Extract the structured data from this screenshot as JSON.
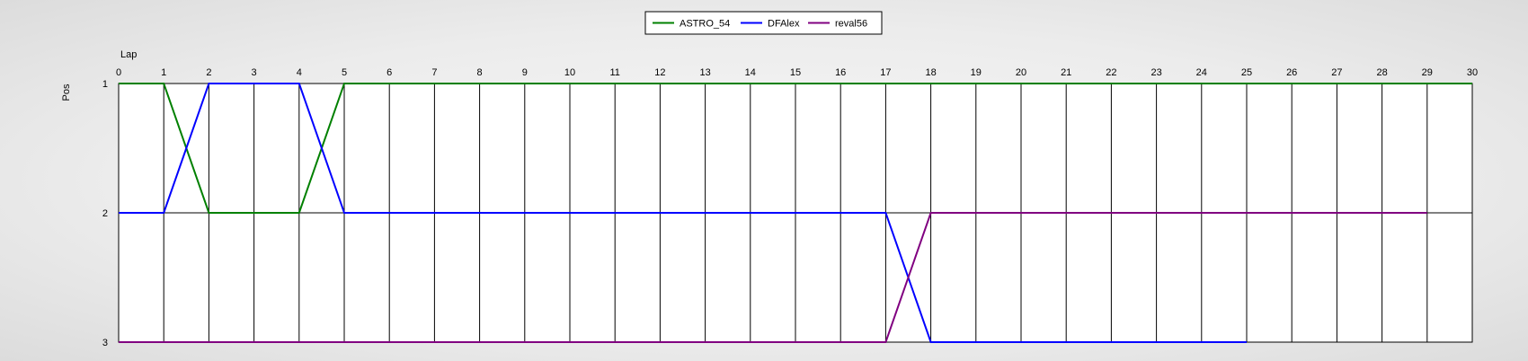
{
  "chart_data": {
    "type": "line",
    "xlabel": "Lap",
    "ylabel": "Pos",
    "xlim": [
      0,
      30
    ],
    "ylim": [
      1,
      3
    ],
    "y_inverted": true,
    "x_ticks": [
      0,
      1,
      2,
      3,
      4,
      5,
      6,
      7,
      8,
      9,
      10,
      11,
      12,
      13,
      14,
      15,
      16,
      17,
      18,
      19,
      20,
      21,
      22,
      23,
      24,
      25,
      26,
      27,
      28,
      29,
      30
    ],
    "y_ticks": [
      1,
      2,
      3
    ],
    "x_axis_position": "top",
    "grid": true,
    "legend_position": "top-center",
    "series": [
      {
        "name": "ASTRO_54",
        "color": "#008000",
        "x": [
          0,
          1,
          2,
          3,
          4,
          5,
          6,
          7,
          8,
          9,
          10,
          11,
          12,
          13,
          14,
          15,
          16,
          17,
          18,
          19,
          20,
          21,
          22,
          23,
          24,
          25,
          26,
          27,
          28,
          29,
          30
        ],
        "y": [
          1,
          1,
          2,
          2,
          2,
          1,
          1,
          1,
          1,
          1,
          1,
          1,
          1,
          1,
          1,
          1,
          1,
          1,
          1,
          1,
          1,
          1,
          1,
          1,
          1,
          1,
          1,
          1,
          1,
          1,
          1
        ]
      },
      {
        "name": "DFAlex",
        "color": "#0000ff",
        "x": [
          0,
          1,
          2,
          3,
          4,
          5,
          6,
          7,
          8,
          9,
          10,
          11,
          12,
          13,
          14,
          15,
          16,
          17,
          18,
          19,
          20,
          21,
          22,
          23,
          24,
          25
        ],
        "y": [
          2,
          2,
          1,
          1,
          1,
          2,
          2,
          2,
          2,
          2,
          2,
          2,
          2,
          2,
          2,
          2,
          2,
          2,
          3,
          3,
          3,
          3,
          3,
          3,
          3,
          3
        ]
      },
      {
        "name": "reval56",
        "color": "#800080",
        "x": [
          0,
          1,
          2,
          3,
          4,
          5,
          6,
          7,
          8,
          9,
          10,
          11,
          12,
          13,
          14,
          15,
          16,
          17,
          18,
          19,
          20,
          21,
          22,
          23,
          24,
          25,
          26,
          27,
          28,
          29
        ],
        "y": [
          3,
          3,
          3,
          3,
          3,
          3,
          3,
          3,
          3,
          3,
          3,
          3,
          3,
          3,
          3,
          3,
          3,
          3,
          2,
          2,
          2,
          2,
          2,
          2,
          2,
          2,
          2,
          2,
          2,
          2
        ]
      }
    ]
  }
}
